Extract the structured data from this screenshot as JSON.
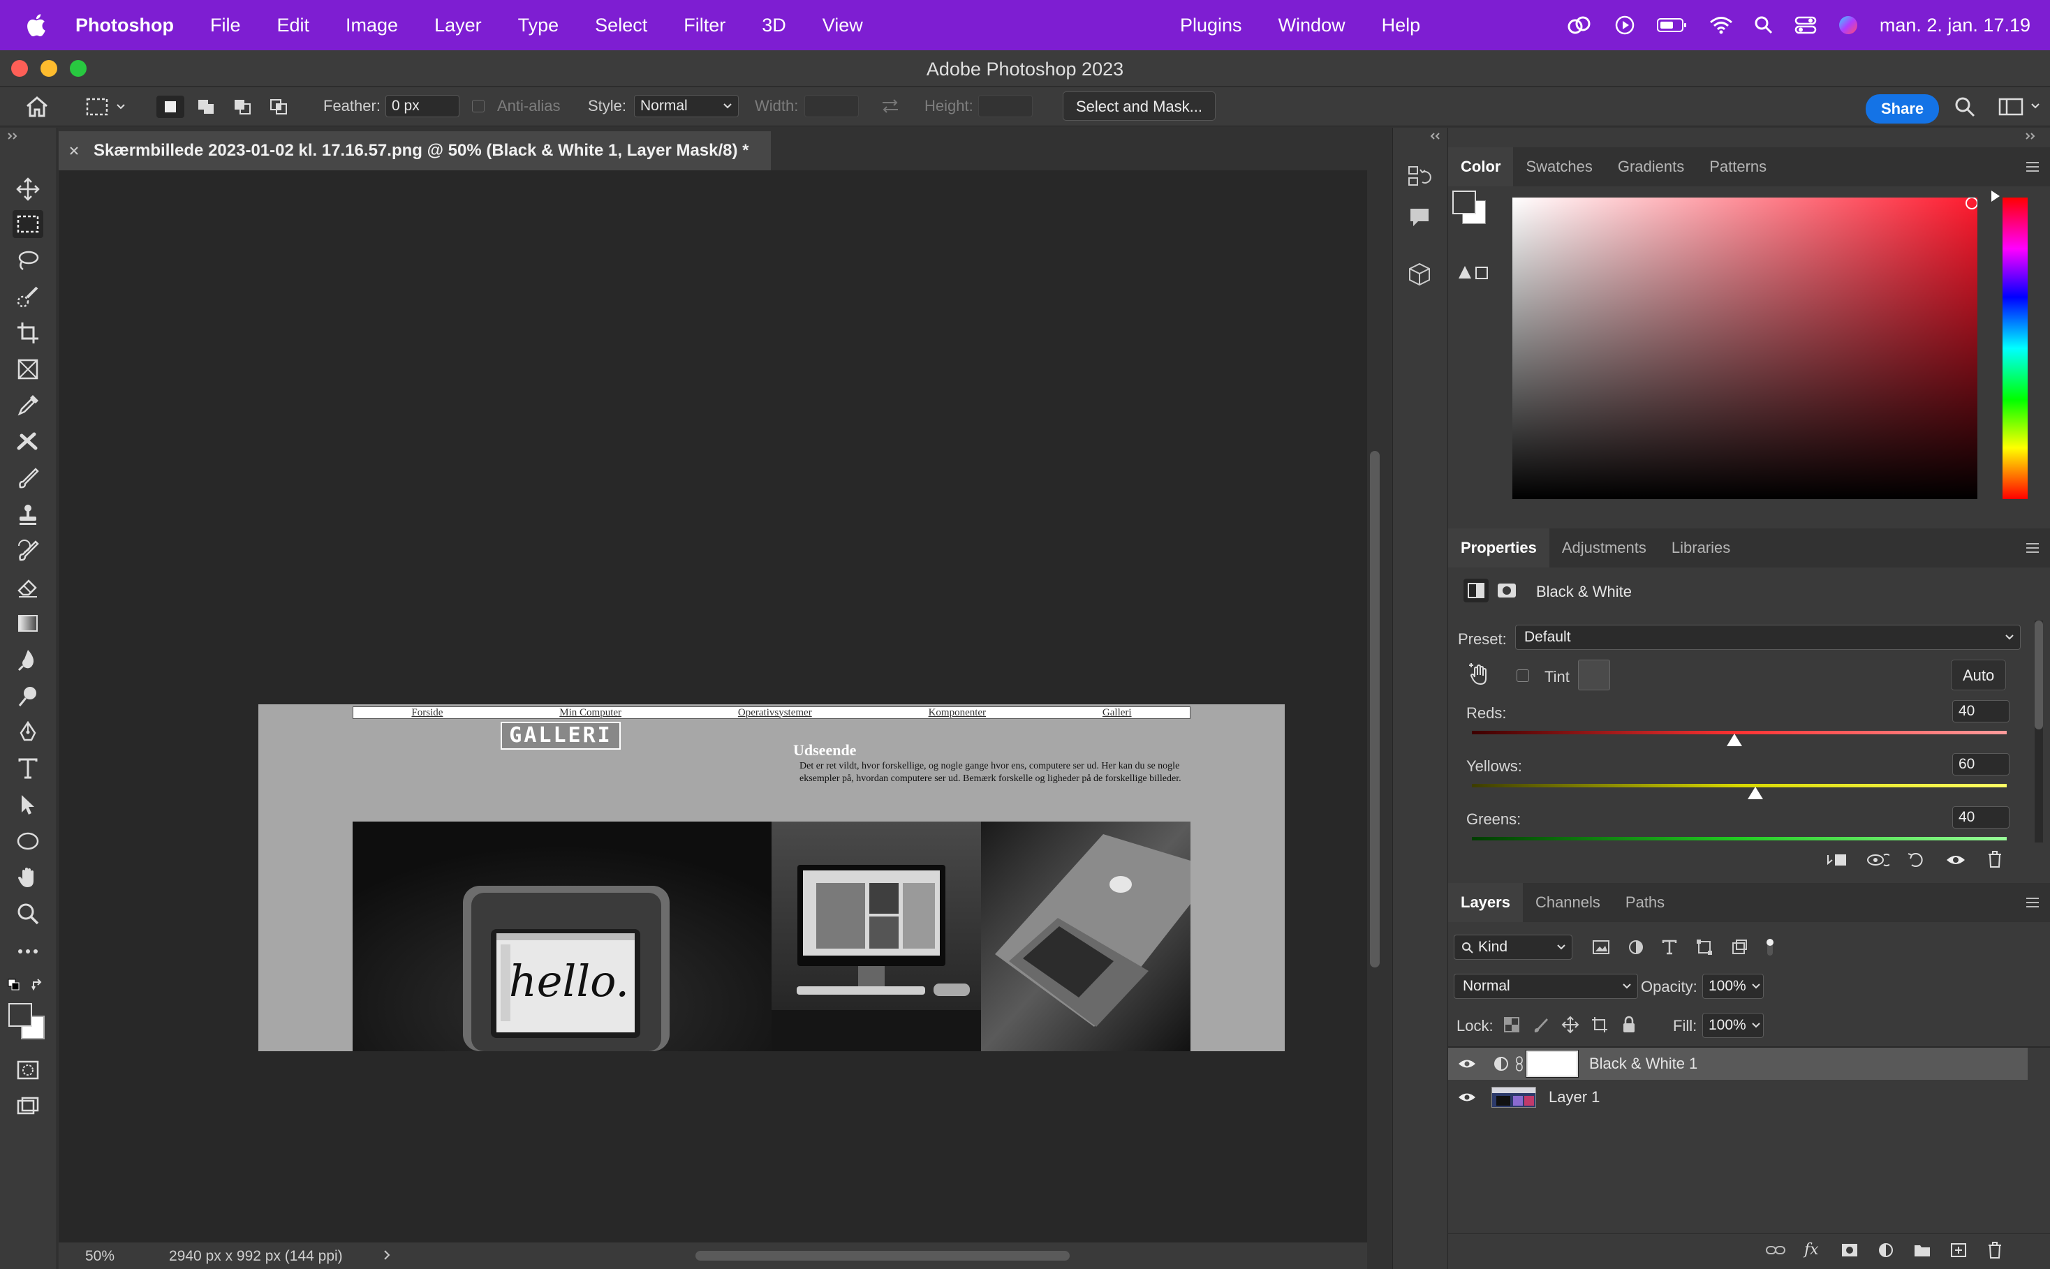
{
  "menubar": {
    "app_name": "Photoshop",
    "menus": [
      "File",
      "Edit",
      "Image",
      "Layer",
      "Type",
      "Select",
      "Filter",
      "3D",
      "View"
    ],
    "right_menus": [
      "Plugins",
      "Window",
      "Help"
    ],
    "clock": "man. 2. jan. 17.19"
  },
  "window": {
    "title": "Adobe Photoshop 2023"
  },
  "options": {
    "feather_label": "Feather:",
    "feather_value": "0 px",
    "antialias_label": "Anti-alias",
    "style_label": "Style:",
    "style_value": "Normal",
    "width_label": "Width:",
    "height_label": "Height:",
    "select_mask_label": "Select and Mask...",
    "share_label": "Share"
  },
  "document_tab": {
    "title": "Skærmbillede 2023-01-02 kl. 17.16.57.png @ 50% (Black & White 1, Layer Mask/8) *"
  },
  "document": {
    "nav": [
      "Forside",
      "Min Computer",
      "Operativsystemer",
      "Komponenter",
      "Galleri"
    ],
    "logo": "GALLERI",
    "heading": "Udseende",
    "body": "Det er ret vildt, hvor forskellige, og nogle gange hvor ens, computere ser ud. Her kan du se nogle eksempler på, hvordan computere ser ud. Bemærk forskelle og ligheder på de forskellige billeder.",
    "photo_text": "hello."
  },
  "status": {
    "zoom": "50%",
    "doc_info": "2940 px x 992 px (144 ppi)"
  },
  "color_panel": {
    "tabs": [
      "Color",
      "Swatches",
      "Gradients",
      "Patterns"
    ],
    "hue_color": "#ff1a2e"
  },
  "properties_panel": {
    "tabs": [
      "Properties",
      "Adjustments",
      "Libraries"
    ],
    "adjustment_name": "Black & White",
    "preset_label": "Preset:",
    "preset_value": "Default",
    "tint_label": "Tint",
    "auto_label": "Auto",
    "sliders": [
      {
        "label": "Reds:",
        "value": "40"
      },
      {
        "label": "Yellows:",
        "value": "60"
      },
      {
        "label": "Greens:",
        "value": "40"
      }
    ]
  },
  "layers_panel": {
    "tabs": [
      "Layers",
      "Channels",
      "Paths"
    ],
    "filter_kind": "Kind",
    "blend_mode": "Normal",
    "opacity_label": "Opacity:",
    "opacity_value": "100%",
    "lock_label": "Lock:",
    "fill_label": "Fill:",
    "fill_value": "100%",
    "layers": [
      {
        "name": "Black & White 1"
      },
      {
        "name": "Layer 1"
      }
    ]
  }
}
